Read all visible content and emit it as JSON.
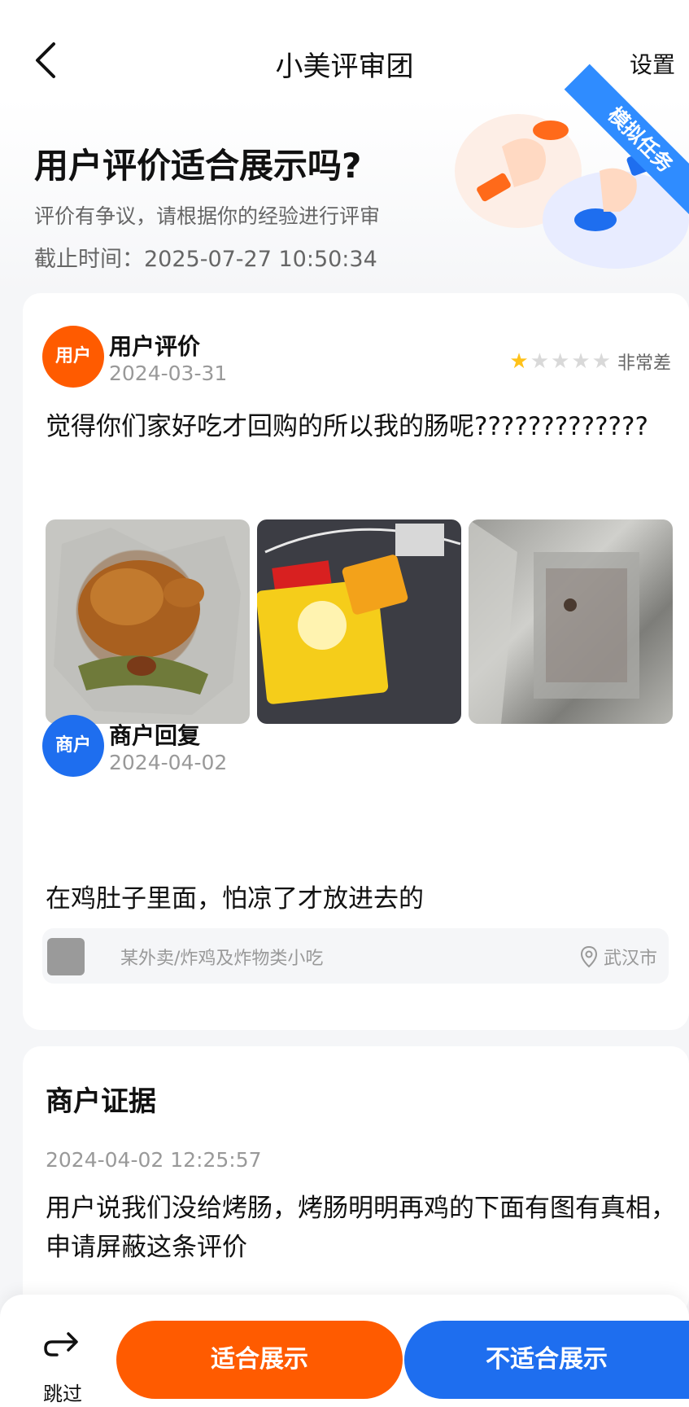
{
  "nav": {
    "title": "小美评审团",
    "settings_label": "设置"
  },
  "header": {
    "title": "用户评价适合展示吗?",
    "subtitle": "评价有争议，请根据你的经验进行评审",
    "deadline": "截止时间：2025-07-27 10:50:34",
    "ribbon": "模拟任务"
  },
  "review": {
    "avatar_label": "用户",
    "name": "用户评价",
    "date": "2024-03-31",
    "rating": 1,
    "rating_max": 5,
    "rating_text": "非常差",
    "text": "觉得你们家好吃才回购的所以我的肠呢?????????????",
    "photos": [
      "roast-chicken-photo",
      "snack-packets-photo",
      "foil-bag-photo"
    ]
  },
  "merchant_reply": {
    "avatar_label": "商户",
    "name": "商户回复",
    "date": "2024-04-02",
    "text": "在鸡肚子里面，怕凉了才放进去的"
  },
  "shop": {
    "name": "某外卖/炸鸡及炸物类小吃",
    "city": "武汉市"
  },
  "evidence": {
    "title": "商户证据",
    "time": "2024-04-02 12:25:57",
    "text": "用户说我们没给烤肠，烤肠明明再鸡的下面有图有真相，申请屏蔽这条评价"
  },
  "actions": {
    "skip_label": "跳过",
    "suitable_label": "适合展示",
    "unsuitable_label": "不适合展示"
  },
  "colors": {
    "accent_orange": "#ff5b00",
    "accent_blue": "#1e6eef",
    "star_on": "#ffc21a"
  }
}
